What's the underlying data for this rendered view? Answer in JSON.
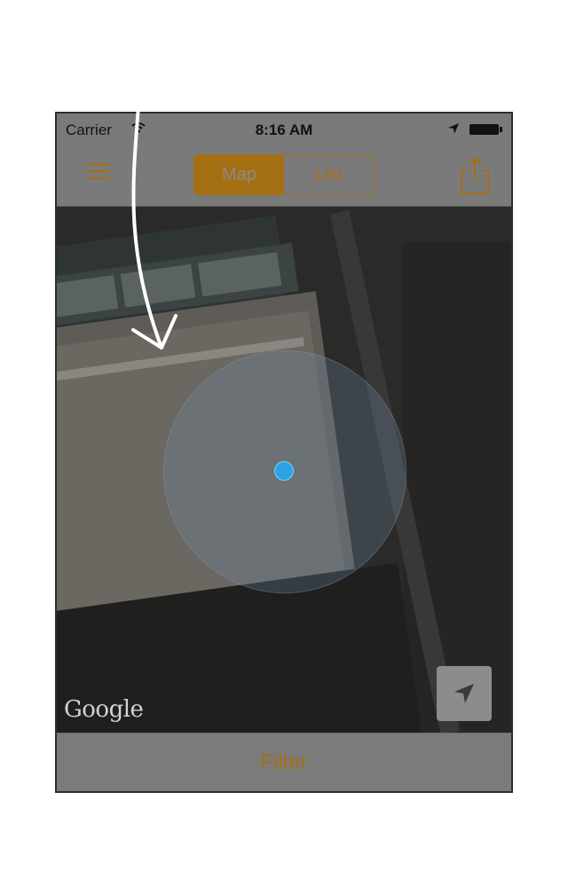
{
  "status_bar": {
    "carrier": "Carrier",
    "time": "8:16 AM"
  },
  "nav": {
    "tabs": [
      {
        "label": "Map",
        "active": true
      },
      {
        "label": "List",
        "active": false
      }
    ],
    "menu_icon": "hamburger-menu-icon",
    "share_icon": "share-icon"
  },
  "map": {
    "attribution": "Google",
    "locate_icon": "location-arrow-icon"
  },
  "bottom_bar": {
    "filter_label": "Filter"
  },
  "colors": {
    "accent": "#a56f14",
    "user_location": "#29a3e6",
    "overlay": "#7a7a7a"
  }
}
